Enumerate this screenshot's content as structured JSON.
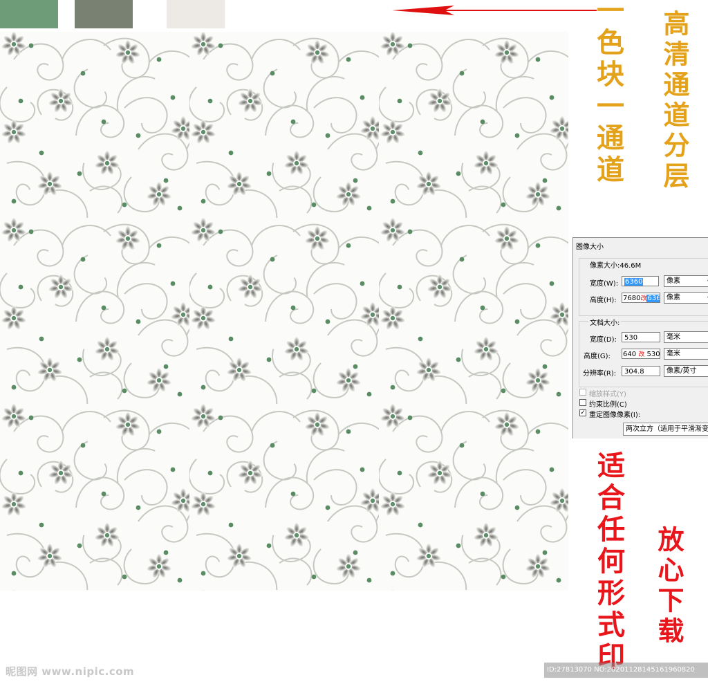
{
  "swatches": [
    {
      "name": "swatch-green",
      "color": "#6e9b78"
    },
    {
      "name": "swatch-olive",
      "color": "#798272"
    },
    {
      "name": "swatch-light",
      "color": "#edeae6"
    }
  ],
  "colors": {
    "pattern_bg": "#fbfbf9",
    "swirl": "#c5c9c1",
    "flower_dark": "#6b6d66",
    "flower_light": "#f4f4f2",
    "flower_center": "#5f8f6a",
    "dot": "#5a8c64",
    "arrow": "#e01010",
    "gold_text": "#e3a21a",
    "red_text": "#e8161b"
  },
  "annotations": {
    "left_vertical": "一色块一通道",
    "right_vertical": "高清通道分层",
    "print_vertical": "适合任何形式印",
    "download_vertical": "放心下载"
  },
  "dialog": {
    "title": "图像大小",
    "pixel_dimensions": "像素大小:46.6M",
    "width_label": "宽度(W):",
    "width_value": "6360",
    "width_unit": "像素",
    "height_label": "高度(H):",
    "height_old": "7680",
    "height_new": "6360",
    "change_mark": "改",
    "height_unit": "像素",
    "doc_size": "文档大小:",
    "doc_width_label": "宽度(D):",
    "doc_width_value": "530",
    "doc_width_unit": "毫米",
    "doc_height_label": "高度(G):",
    "doc_height_old": "640",
    "doc_height_new": "530",
    "doc_height_unit": "毫米",
    "resolution_label": "分辨率(R):",
    "resolution_value": "304.8",
    "resolution_unit": "像素/英寸",
    "scale_styles": "缩放样式(Y)",
    "constrain": "约束比例(C)",
    "resample": "重定图像像素(I):",
    "resample_method": "两次立方（适用于平滑渐变）"
  },
  "watermark": {
    "site": "昵图网 www.nipic.com",
    "id_text": "ID:27813070 NO:20201128145161960820"
  }
}
